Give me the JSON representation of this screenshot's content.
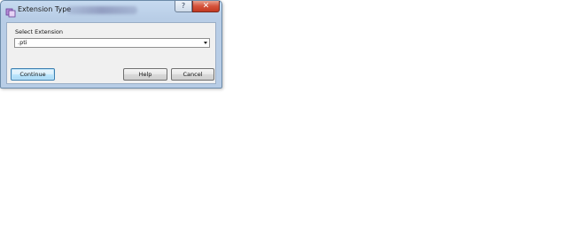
{
  "window": {
    "title": "Extension Type",
    "help_glyph": "?",
    "close_glyph": "✕"
  },
  "form": {
    "select_label": "Select Extension",
    "selected_value": ".pti"
  },
  "buttons": {
    "continue_label": "Continue",
    "help_label": "Help",
    "cancel_label": "Cancel"
  },
  "colors": {
    "close_button": "#c23a22",
    "default_button_border": "#3c7fb1",
    "title_bar": "#c6daf0"
  },
  "icons": {
    "title_icon": "app-icon",
    "dropdown_arrow": "chevron-down-icon"
  }
}
